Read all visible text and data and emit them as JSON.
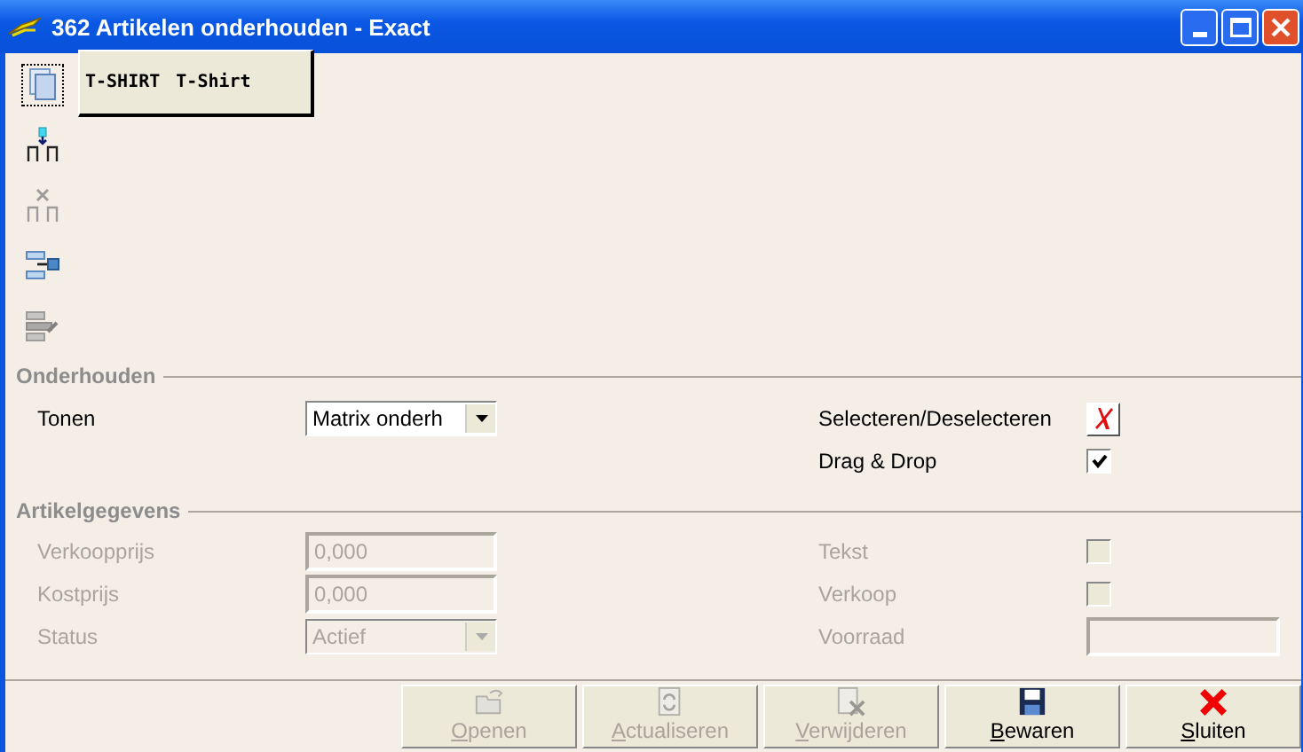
{
  "window": {
    "title": "362 Artikelen onderhouden - Exact"
  },
  "tree_tools": [
    {
      "kind": "pages",
      "focused": true,
      "disabled": false
    },
    {
      "kind": "add-node",
      "focused": false,
      "disabled": false
    },
    {
      "kind": "remove-node",
      "focused": false,
      "disabled": true
    },
    {
      "kind": "link",
      "focused": false,
      "disabled": false
    },
    {
      "kind": "export",
      "focused": false,
      "disabled": true
    }
  ],
  "node": {
    "code": "T-SHIRT",
    "description": "T-Shirt"
  },
  "sections": [
    {
      "title": "Onderhouden",
      "left": [
        {
          "kind": "dropdown",
          "label": "Tonen",
          "value": "Matrix onderh",
          "disabled": false
        }
      ],
      "right": [
        {
          "kind": "button",
          "label": "Selecteren/Deselecteren",
          "disabled": false
        },
        {
          "kind": "checkbox",
          "label": "Drag & Drop",
          "checked": true,
          "disabled": false
        }
      ]
    },
    {
      "title": "Artikelgegevens",
      "left": [
        {
          "kind": "text",
          "label": "Verkoopprijs",
          "value": "0,000",
          "disabled": true
        },
        {
          "kind": "text",
          "label": "Kostprijs",
          "value": "0,000",
          "disabled": true
        },
        {
          "kind": "dropdown",
          "label": "Status",
          "value": "Actief",
          "disabled": true
        }
      ],
      "right": [
        {
          "kind": "checkbox",
          "label": "Tekst",
          "checked": false,
          "disabled": true
        },
        {
          "kind": "checkbox",
          "label": "Verkoop",
          "checked": false,
          "disabled": true
        },
        {
          "kind": "text",
          "label": "Voorraad",
          "disabled": true
        }
      ]
    }
  ],
  "buttons": [
    {
      "kind": "open",
      "label": "Openen",
      "disabled": true
    },
    {
      "kind": "refresh",
      "label": "Actualiseren",
      "disabled": true
    },
    {
      "kind": "delete",
      "label": "Verwijderen",
      "disabled": true
    },
    {
      "kind": "save",
      "label": "Bewaren",
      "disabled": false
    },
    {
      "kind": "close",
      "label": "Sluiten",
      "disabled": false
    }
  ]
}
